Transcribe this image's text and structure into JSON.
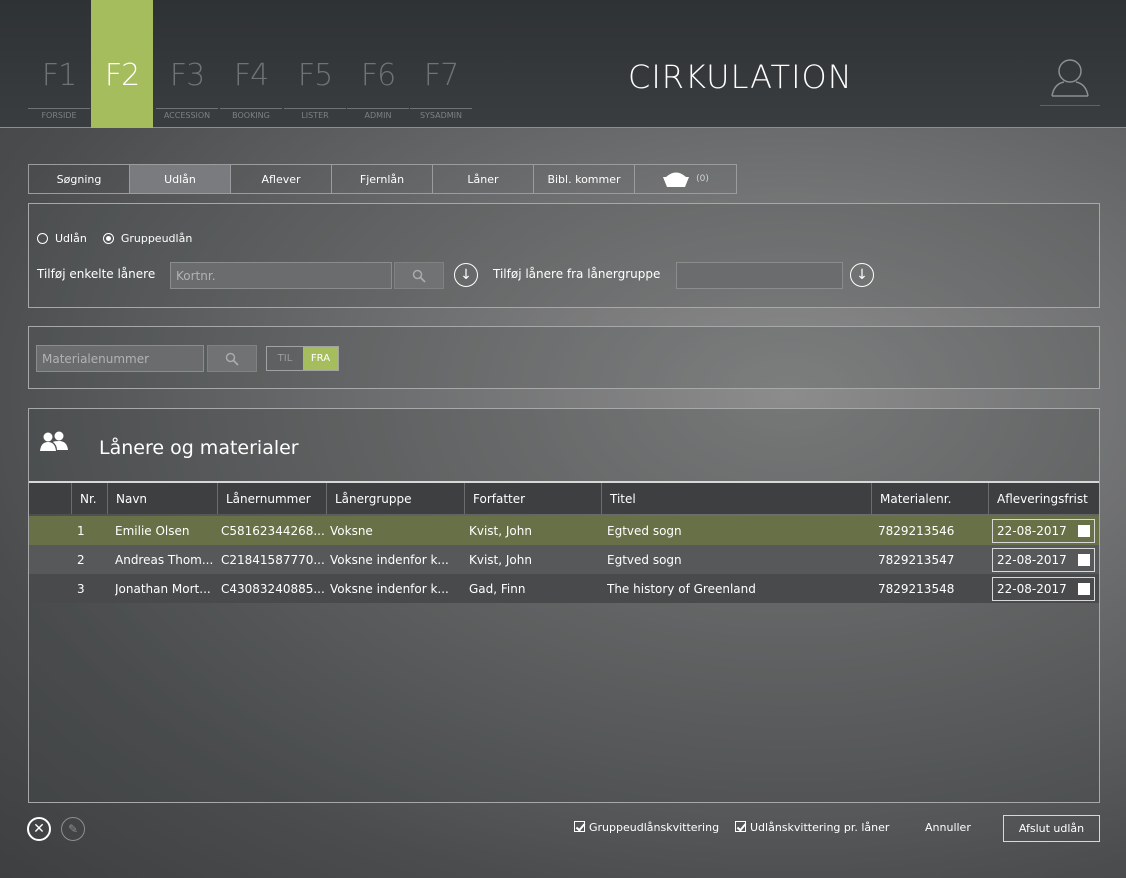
{
  "app_title": "CIRKULATION",
  "fkeys": [
    {
      "key": "F1",
      "label": "FORSIDE"
    },
    {
      "key": "F2",
      "label": ""
    },
    {
      "key": "F3",
      "label": "ACCESSION"
    },
    {
      "key": "F4",
      "label": "BOOKING"
    },
    {
      "key": "F5",
      "label": "LISTER"
    },
    {
      "key": "F6",
      "label": "ADMIN"
    },
    {
      "key": "F7",
      "label": "SYSADMIN"
    }
  ],
  "tabs": [
    "Søgning",
    "Udlån",
    "Aflever",
    "Fjernlån",
    "Låner",
    "Bibl. kommer"
  ],
  "basket_count": "(0)",
  "loan_panel": {
    "radio_udlan": "Udlån",
    "radio_gruppe": "Gruppeudlån",
    "add_single_label": "Tilføj enkelte lånere",
    "card_placeholder": "Kortnr.",
    "add_group_label": "Tilføj lånere fra lånergruppe"
  },
  "material_panel": {
    "material_placeholder": "Materialenummer",
    "til": "TIL",
    "fra": "FRA"
  },
  "table_panel": {
    "title": "Lånere og materialer",
    "columns": [
      "Nr.",
      "Navn",
      "Lånernummer",
      "Lånergruppe",
      "Forfatter",
      "Titel",
      "Materialenr.",
      "Afleveringsfrist"
    ],
    "rows": [
      [
        "1",
        "Emilie Olsen",
        "C58162344268...",
        "Voksne",
        "Kvist, John",
        "Egtved sogn",
        "7829213546",
        "22-08-2017"
      ],
      [
        "2",
        "Andreas Thom...",
        "C21841587770...",
        "Voksne indenfor k...",
        "Kvist, John",
        "Egtved sogn",
        "7829213547",
        "22-08-2017"
      ],
      [
        "3",
        "Jonathan Mort...",
        "C43083240885...",
        "Voksne indenfor k...",
        "Gad, Finn",
        "The history of Greenland",
        "7829213548",
        "22-08-2017"
      ]
    ]
  },
  "footer": {
    "chk_group": "Gruppeudlånskvittering",
    "chk_loan": "Udlånskvittering pr. låner",
    "cancel": "Annuller",
    "finish": "Afslut udlån"
  }
}
